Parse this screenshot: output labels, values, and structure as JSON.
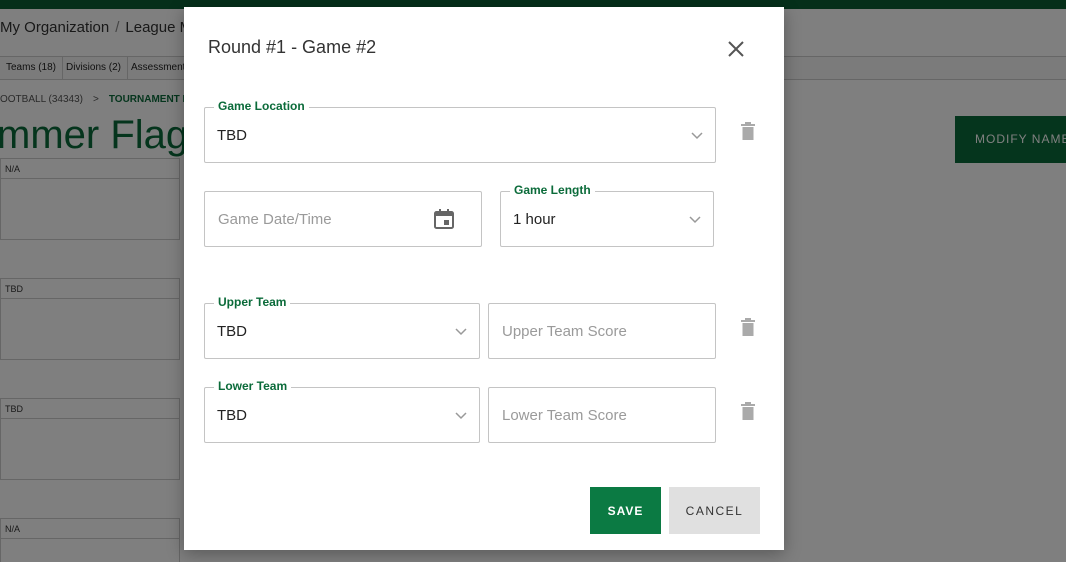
{
  "background": {
    "breadcrumbs": [
      "My Organization",
      "League Ma"
    ],
    "tabs": [
      "Teams (18)",
      "Divisions (2)",
      "Assessment"
    ],
    "subcrumb": {
      "parent": "OOTBALL (34343)",
      "current": "TOURNAMENT L"
    },
    "page_title": "mmer Flag Fo",
    "modify_button": "MODIFY NAME",
    "cards": [
      "N/A",
      "TBD",
      "TBD",
      "N/A"
    ]
  },
  "modal": {
    "title": "Round #1 - Game #2",
    "game_location": {
      "label": "Game Location",
      "value": "TBD"
    },
    "game_date": {
      "placeholder": "Game Date/Time"
    },
    "game_length": {
      "label": "Game Length",
      "value": "1 hour"
    },
    "upper_team": {
      "label": "Upper Team",
      "value": "TBD",
      "score_placeholder": "Upper Team Score"
    },
    "lower_team": {
      "label": "Lower Team",
      "value": "TBD",
      "score_placeholder": "Lower Team Score"
    },
    "save_label": "SAVE",
    "cancel_label": "CANCEL"
  },
  "colors": {
    "brand_green": "#0b7a43",
    "overlay": "rgba(0,0,0,0.5)"
  },
  "icons": [
    "close-icon",
    "trash-icon",
    "chevron-down-icon",
    "calendar-icon"
  ]
}
